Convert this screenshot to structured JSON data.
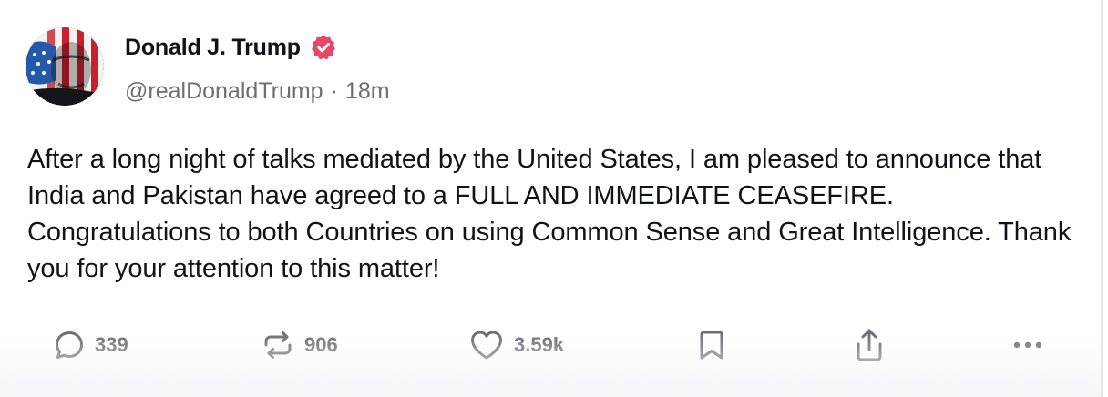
{
  "post": {
    "author": {
      "display_name": "Donald J. Trump",
      "verified": true,
      "handle": "@realDonaldTrump",
      "time_ago": "18m",
      "separator": "·"
    },
    "text": "After a long night of talks mediated by the United States, I am pleased to announce that India and Pakistan have agreed to a FULL AND IMMEDIATE CEASEFIRE. Congratulations to both Countries on using Common Sense and Great Intelligence. Thank you for your attention to this matter!",
    "actions": {
      "replies": {
        "icon": "reply-icon",
        "count": "339"
      },
      "reposts": {
        "icon": "repost-icon",
        "count": "906"
      },
      "likes": {
        "icon": "heart-icon",
        "count": "3.59k"
      },
      "bookmark": {
        "icon": "bookmark-icon"
      },
      "share": {
        "icon": "share-icon"
      },
      "more": {
        "icon": "more-icon"
      }
    }
  },
  "colors": {
    "text_primary": "#0f1419",
    "text_secondary": "#6b6f76",
    "verified_badge": "#e8466b",
    "background": "#ffffff"
  }
}
